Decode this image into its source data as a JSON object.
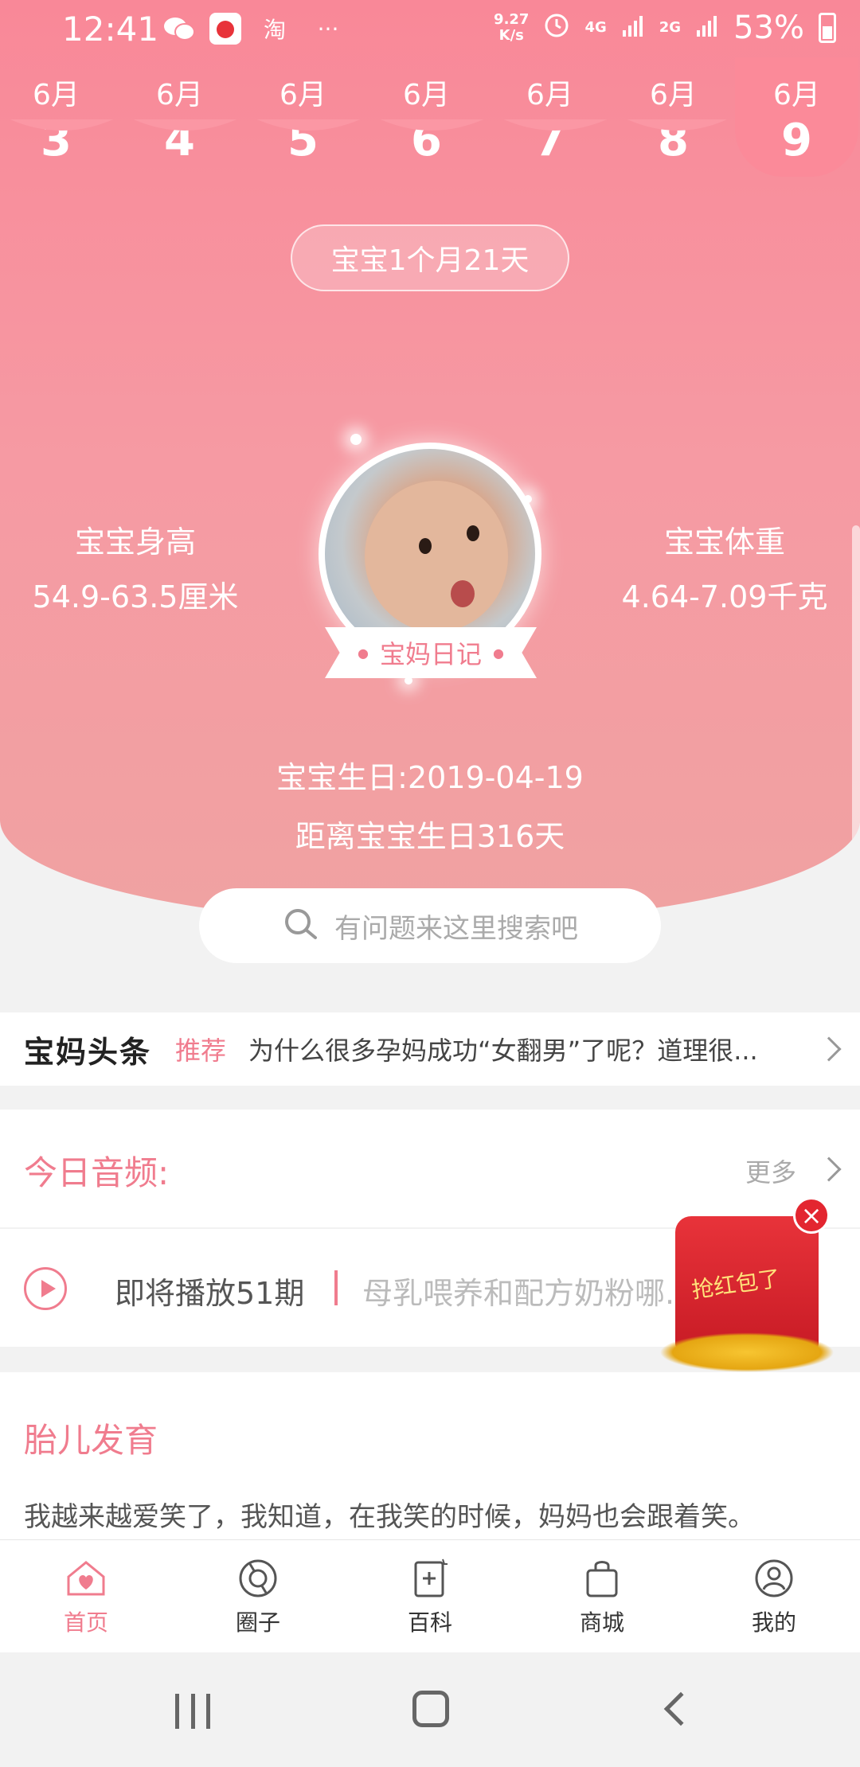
{
  "status_bar": {
    "time": "12:41",
    "app_icons": [
      "wechat-icon",
      "app-icon",
      "taobao-icon"
    ],
    "more": "···",
    "net_speed_top": "9.27",
    "net_speed_bottom": "K/s",
    "signal_a": "4G",
    "signal_b": "2G",
    "battery": "53%"
  },
  "dates": [
    {
      "month": "6月",
      "day": "3"
    },
    {
      "month": "6月",
      "day": "4"
    },
    {
      "month": "6月",
      "day": "5"
    },
    {
      "month": "6月",
      "day": "6"
    },
    {
      "month": "6月",
      "day": "7"
    },
    {
      "month": "6月",
      "day": "8"
    },
    {
      "month": "6月",
      "day": "9",
      "active": true
    }
  ],
  "hero": {
    "age": "宝宝1个月21天",
    "height_label": "宝宝身高",
    "height_value": "54.9-63.5厘米",
    "weight_label": "宝宝体重",
    "weight_value": "4.64-7.09千克",
    "diary_tag": "宝妈日记",
    "birthday": "宝宝生日:2019-04-19",
    "countdown": "距离宝宝生日316天"
  },
  "search": {
    "placeholder": "有问题来这里搜索吧"
  },
  "news": {
    "brand": "宝妈头条",
    "tag": "推荐",
    "headline": "为什么很多孕妈成功“女翻男”了呢？道理很..."
  },
  "audio": {
    "title": "今日音频:",
    "more": "更多",
    "episode": "即将播放51期",
    "name": "母乳喂养和配方奶粉哪..."
  },
  "red_packet": {
    "label": "抢红包了"
  },
  "fetal": {
    "title": "胎儿发育",
    "text": "我越来越爱笑了，我知道，在我笑的时候，妈妈也会跟着笑。"
  },
  "tabs": [
    {
      "label": "首页",
      "icon": "home-heart-icon",
      "active": true
    },
    {
      "label": "圈子",
      "icon": "circle-community-icon"
    },
    {
      "label": "百科",
      "icon": "encyclopedia-icon"
    },
    {
      "label": "商城",
      "icon": "shopping-bag-icon"
    },
    {
      "label": "我的",
      "icon": "profile-icon"
    }
  ],
  "colors": {
    "accent": "#f07c8e",
    "hero_top": "#f98898",
    "hero_bottom": "#f0a2a2"
  }
}
